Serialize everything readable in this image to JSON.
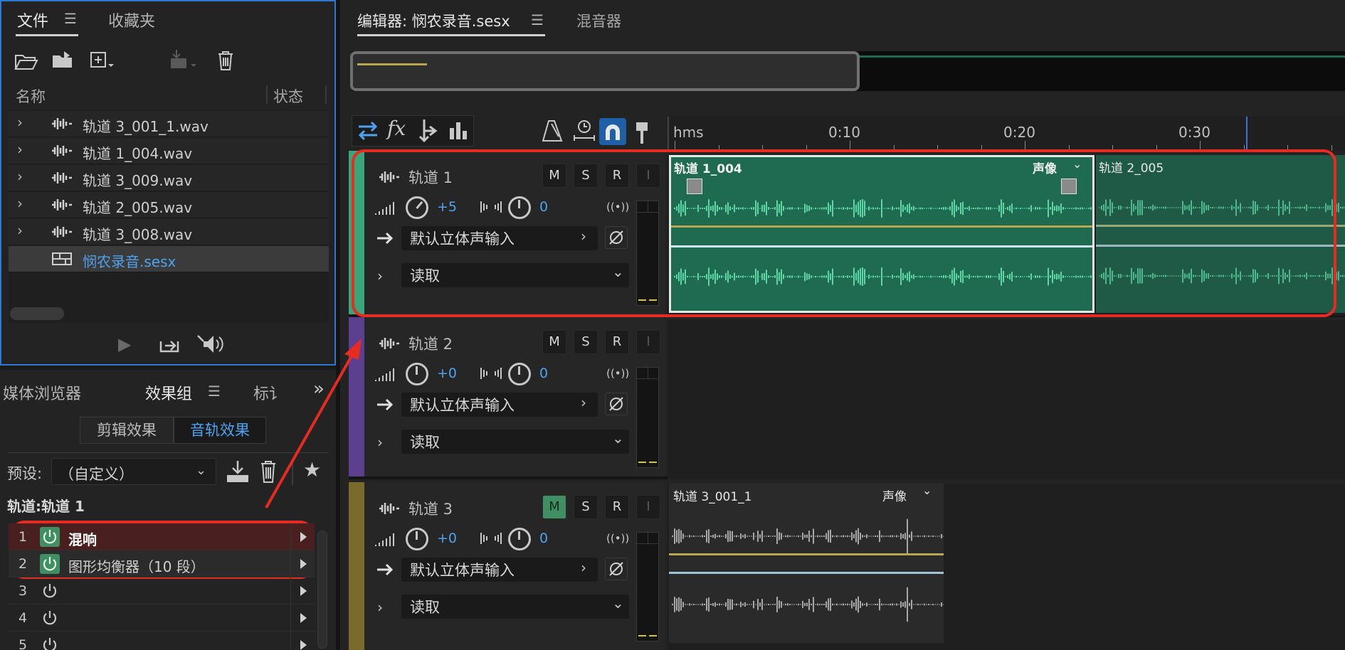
{
  "files_panel": {
    "tab_files": "文件",
    "tab_favorites": "收藏夹",
    "col_name": "名称",
    "col_status": "状态",
    "files": [
      {
        "name": "轨道 3_001_1.wav",
        "expandable": true
      },
      {
        "name": "轨道 1_004.wav",
        "expandable": true
      },
      {
        "name": "轨道 3_009.wav",
        "expandable": true
      },
      {
        "name": "轨道 2_005.wav",
        "expandable": true
      },
      {
        "name": "轨道 3_008.wav",
        "expandable": true
      },
      {
        "name": "悯农录音.sesx",
        "expandable": false
      }
    ]
  },
  "effects_panel": {
    "tab_media": "媒体浏览器",
    "tab_effects": "效果组",
    "tab_markers": "标讠",
    "seg_clip": "剪辑效果",
    "seg_track": "音轨效果",
    "preset_label": "预设:",
    "preset_value": "（自定义）",
    "track_label": "轨道:轨道 1",
    "effects": [
      {
        "num": "1",
        "name": "混响",
        "on": true
      },
      {
        "num": "2",
        "name": "图形均衡器（10 段）",
        "on": true
      },
      {
        "num": "3",
        "name": "",
        "on": false
      },
      {
        "num": "4",
        "name": "",
        "on": false
      },
      {
        "num": "5",
        "name": "",
        "on": false
      }
    ]
  },
  "editor": {
    "tab_editor": "编辑器: 悯农录音.sesx",
    "tab_mixer": "混音器",
    "ruler": {
      "unit": "hms",
      "ticks": [
        "0:10",
        "0:20",
        "0:30"
      ]
    },
    "tracks": [
      {
        "name": "轨道 1",
        "vol": "+5",
        "pan": "0",
        "input": "默认立体声输入",
        "mode": "读取",
        "color": "#3aa57a",
        "m_on": false
      },
      {
        "name": "轨道 2",
        "vol": "+0",
        "pan": "0",
        "input": "默认立体声输入",
        "mode": "读取",
        "color": "#5c3f8f",
        "m_on": false
      },
      {
        "name": "轨道 3",
        "vol": "+0",
        "pan": "0",
        "input": "默认立体声输入",
        "mode": "读取",
        "color": "#7a6a2b",
        "m_on": true
      }
    ],
    "buttons": {
      "m": "M",
      "s": "S",
      "r": "R",
      "i": "I"
    },
    "clips": [
      {
        "name": "轨道 1_004",
        "pan_label": "声像"
      },
      {
        "name": "轨道 2_005",
        "pan_label": ""
      },
      {
        "name": "轨道 3_001_1",
        "pan_label": "声像"
      }
    ]
  },
  "colors": {
    "accent": "#2e78d1",
    "clip_green": "#1f6b52",
    "annotation_red": "#e62b23"
  }
}
